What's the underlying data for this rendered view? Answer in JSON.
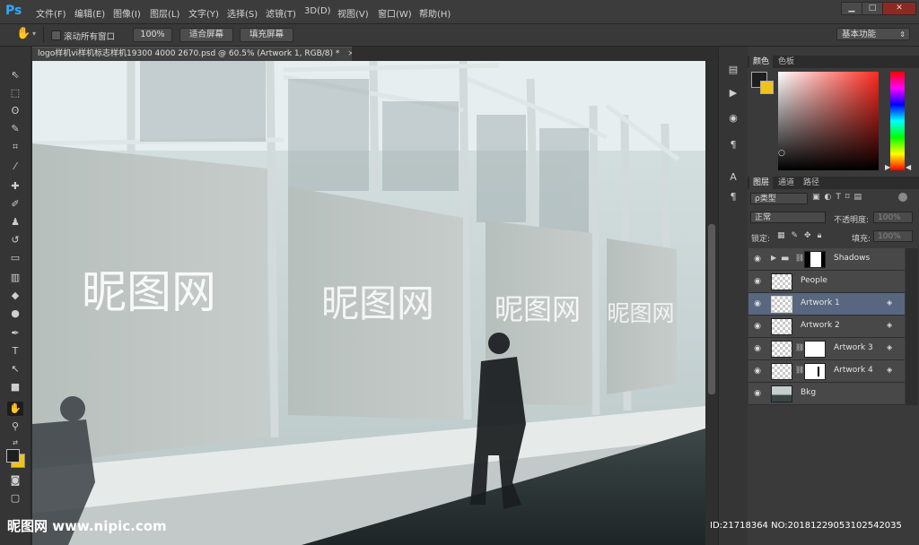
{
  "app": {
    "logo": "Ps"
  },
  "menu": [
    "文件(F)",
    "编辑(E)",
    "图像(I)",
    "图层(L)",
    "文字(Y)",
    "选择(S)",
    "滤镜(T)",
    "3D(D)",
    "视图(V)",
    "窗口(W)",
    "帮助(H)"
  ],
  "window_controls": {
    "minimize": "▁",
    "maximize": "□",
    "close": "✕"
  },
  "options": {
    "scroll_all_label": "滚动所有窗口",
    "zoom_label": "100%",
    "fit_screen_label": "适合屏幕",
    "fill_screen_label": "填充屏幕",
    "workspace": "基本功能"
  },
  "document": {
    "tab_title": "logo样机vi样机标志样机19300 4000 2670.psd @ 60.5% (Artwork 1, RGB/8) *",
    "close_glyph": "×"
  },
  "canvas_art": {
    "sign_text": "昵图网"
  },
  "color_panel": {
    "tabs": [
      "颜色",
      "色板"
    ],
    "foreground": "#1e1e1e",
    "background": "#f2c21c",
    "picker_hue": "#ff2a20"
  },
  "layers_panel": {
    "tabs": [
      "图层",
      "通道",
      "路径"
    ],
    "filter_label": "ρ类型",
    "blend_mode": "正常",
    "opacity_label": "不透明度:",
    "opacity_value": "100%",
    "lock_label": "锁定:",
    "fill_label": "填充:",
    "fill_value": "100%",
    "layers": [
      {
        "name": "Shadows",
        "type": "group",
        "selected": false
      },
      {
        "name": "People",
        "type": "layer",
        "selected": false
      },
      {
        "name": "Artwork 1",
        "type": "smart",
        "selected": true
      },
      {
        "name": "Artwork 2",
        "type": "smart",
        "selected": false
      },
      {
        "name": "Artwork 3",
        "type": "smart-masked",
        "selected": false
      },
      {
        "name": "Artwork 4",
        "type": "smart-masked",
        "selected": false
      },
      {
        "name": "Bkg",
        "type": "image",
        "selected": false
      }
    ]
  },
  "watermark": {
    "left": "昵图网 www.nipic.com",
    "right": "ID:21718364 NO:20181229053102542035"
  },
  "accent": "#31a8ff"
}
